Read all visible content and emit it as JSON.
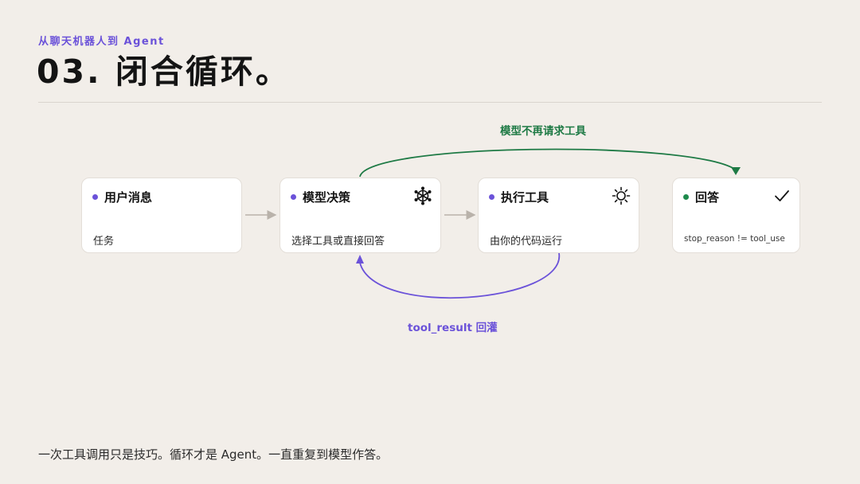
{
  "header": {
    "kicker": "从聊天机器人到 Agent",
    "title": "03. 闭合循环。"
  },
  "nodes": [
    {
      "id": "user-message",
      "label": "用户消息",
      "sub": "任务",
      "dot_color": "#6b52d9"
    },
    {
      "id": "model-decision",
      "label": "模型决策",
      "sub": "选择工具或直接回答",
      "dot_color": "#6b52d9",
      "icon": "network-hub-icon"
    },
    {
      "id": "execute-tool",
      "label": "执行工具",
      "sub": "由你的代码运行",
      "dot_color": "#6b52d9",
      "icon": "sun-gear-icon"
    },
    {
      "id": "answer",
      "label": "回答",
      "sub": "stop_reason != tool_use",
      "dot_color": "#1e8a4c",
      "icon": "checkmark-icon"
    }
  ],
  "edges": {
    "stop_label": "模型不再请求工具",
    "feedback_label": "tool_result 回灌"
  },
  "colors": {
    "accent": "#6b52d9",
    "green": "#1e8a4c",
    "background": "#f2eee9"
  },
  "footer": {
    "text": "一次工具调用只是技巧。循环才是 Agent。一直重复到模型作答。"
  }
}
